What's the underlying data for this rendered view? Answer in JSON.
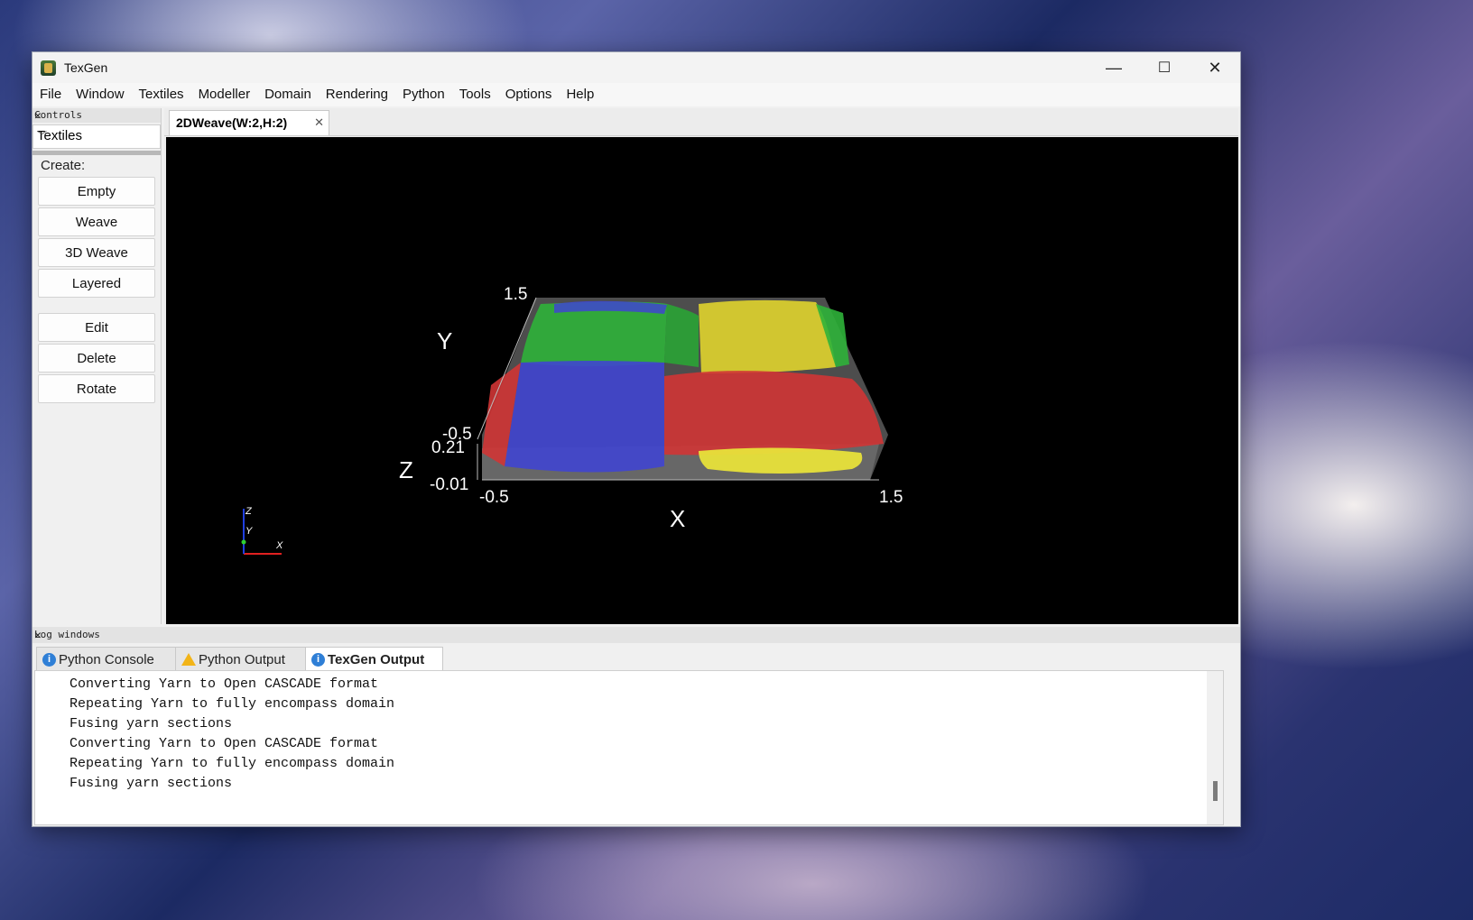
{
  "window": {
    "title": "TexGen",
    "minimize_glyph": "—",
    "maximize_glyph": "☐",
    "close_glyph": "✕"
  },
  "menu": [
    "File",
    "Window",
    "Textiles",
    "Modeller",
    "Domain",
    "Rendering",
    "Python",
    "Tools",
    "Options",
    "Help"
  ],
  "controls": {
    "dock_title": "Controls",
    "combo_value": "Textiles",
    "create_label": "Create:",
    "buttons_create": [
      "Empty",
      "Weave",
      "3D Weave",
      "Layered"
    ],
    "buttons_actions": [
      "Edit",
      "Delete",
      "Rotate"
    ]
  },
  "document_tab": {
    "label": "2DWeave(W:2,H:2)"
  },
  "viewport": {
    "axis_labels": {
      "x": "X",
      "y": "Y",
      "z": "Z"
    },
    "x_ticks": [
      "-0.5",
      "1.5"
    ],
    "y_ticks": [
      "-0.5",
      "1.5"
    ],
    "z_ticks": [
      "-0.01",
      "0.21"
    ],
    "orientation_axes": {
      "x": "X",
      "y": "Y",
      "z": "Z"
    },
    "yarn_colors": {
      "red": "#d03535",
      "green": "#2fb33a",
      "blue": "#4045d0",
      "yellow": "#d8cc2e"
    },
    "background": "#000000"
  },
  "logs": {
    "dock_title": "Log windows",
    "tabs": [
      {
        "label": "Python Console",
        "icon": "info-icon"
      },
      {
        "label": "Python Output",
        "icon": "warning-icon"
      },
      {
        "label": "TexGen Output",
        "icon": "info-icon"
      }
    ],
    "active_tab": "TexGen Output",
    "lines": [
      "Converting Yarn to Open CASCADE format",
      "Repeating Yarn to fully encompass domain",
      "Fusing yarn sections",
      "Converting Yarn to Open CASCADE format",
      "Repeating Yarn to fully encompass domain",
      "Fusing yarn sections"
    ]
  }
}
